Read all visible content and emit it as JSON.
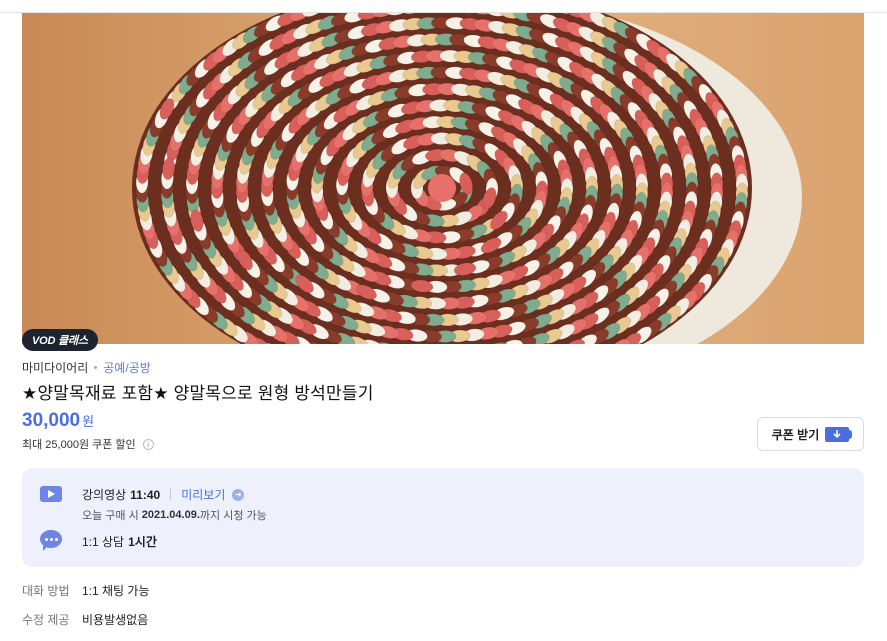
{
  "badge": {
    "label": "VOD 클래스"
  },
  "class_info": {
    "creator": "마미다이어리",
    "category": "공예/공방",
    "title": "★양말목재료 포함★ 양말목으로 원형 방석만들기",
    "price": "30,000",
    "currency": "원",
    "discount_text": "최대 25,000원 쿠폰 할인",
    "coupon_button": "쿠폰 받기"
  },
  "lecture": {
    "video_label": "강의영상",
    "video_length": "11:40",
    "preview_label": "미리보기",
    "purchase_prefix": "오늘 구매 시",
    "purchase_date": "2021.04.09.",
    "purchase_suffix": "까지 시청 가능",
    "consult_label": "1:1 상담",
    "consult_time": "1시간"
  },
  "details": [
    {
      "key": "대화 방법",
      "value": "1:1 채팅 가능"
    },
    {
      "key": "수정 제공",
      "value": "비용발생없음"
    }
  ],
  "colors": {
    "accent": "#4a6ee0",
    "box_bg": "#eef1fb",
    "badge_bg": "#1f2330"
  },
  "icons": [
    "play-icon",
    "chat-icon",
    "info-icon",
    "download-icon",
    "arrow-right-icon"
  ]
}
